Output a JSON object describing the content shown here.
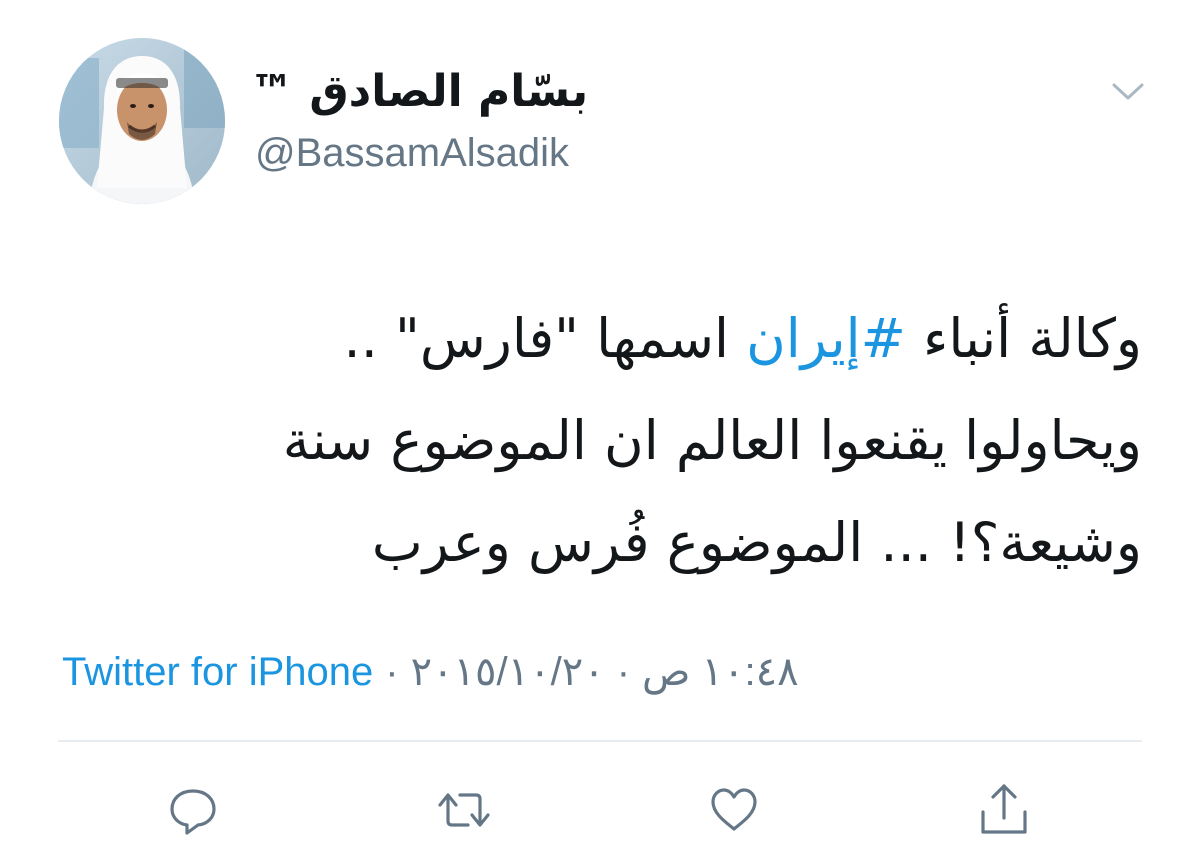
{
  "tweet": {
    "author": {
      "display_name": "بسّام الصادق ™",
      "handle": "@BassamAlsadik",
      "avatar": "profile-photo"
    },
    "text_lines": [
      {
        "before": "وكالة أنباء ",
        "hashtag": "#إيران",
        "after": " اسمها  \"فارس\" .."
      },
      {
        "before": "ويحاولوا يقنعوا العالم ان الموضوع سنة",
        "hashtag": "",
        "after": ""
      },
      {
        "before": "وشيعة؟! ... الموضوع فُرس وعرب",
        "hashtag": "",
        "after": ""
      }
    ],
    "meta": {
      "time": "١٠:٤٨ ص",
      "date": "٢٠١٥/١٠/٢٠",
      "separator": "·",
      "source": "Twitter for iPhone"
    },
    "actions": {
      "reply": "reply-icon",
      "retweet": "retweet-icon",
      "like": "heart-icon",
      "share": "share-icon"
    }
  },
  "colors": {
    "link_blue": "#1b95e0",
    "secondary_gray": "#657786",
    "text_dark": "#14171a",
    "divider": "#e6ecf0"
  }
}
